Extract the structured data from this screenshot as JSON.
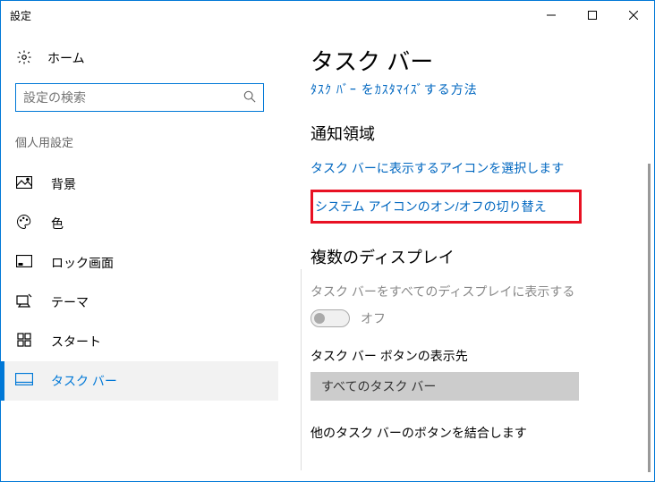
{
  "window": {
    "title": "設定"
  },
  "home": {
    "label": "ホーム"
  },
  "search": {
    "placeholder": "設定の検索"
  },
  "section_label": "個人用設定",
  "nav": {
    "items": [
      {
        "label": "背景"
      },
      {
        "label": "色"
      },
      {
        "label": "ロック画面"
      },
      {
        "label": "テーマ"
      },
      {
        "label": "スタート"
      },
      {
        "label": "タスク バー"
      }
    ]
  },
  "main": {
    "title": "タスク バー",
    "cut_link": "ﾀｽｸ ﾊﾞｰ をｶｽﾀﾏｲｽﾞする方法",
    "notif_header": "通知領域",
    "link_select_icons": "タスク バーに表示するアイコンを選択します",
    "link_system_icons": "システム アイコンのオン/オフの切り替え",
    "multi_display_header": "複数のディスプレイ",
    "multi_display_desc": "タスク バーをすべてのディスプレイに表示する",
    "toggle_state": "オフ",
    "taskbar_button_label": "タスク バー ボタンの表示先",
    "dropdown_value": "すべてのタスク バー",
    "combine_label": "他のタスク バーのボタンを結合します"
  }
}
